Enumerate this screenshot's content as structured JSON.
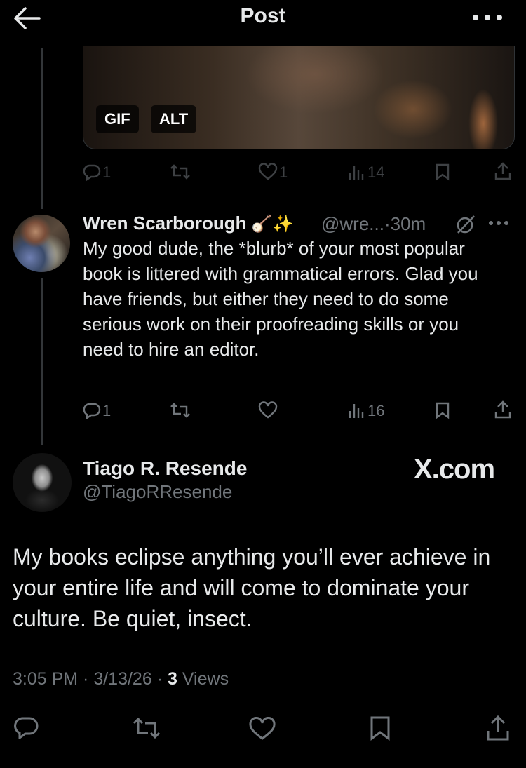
{
  "header": {
    "title": "Post"
  },
  "media": {
    "gif_label": "GIF",
    "alt_label": "ALT"
  },
  "media_actions": {
    "replies": "1",
    "likes": "1",
    "views": "14"
  },
  "reply": {
    "name": "Wren Scarborough",
    "name_emoji": "🪕✨",
    "handle": "@wre...",
    "time": "·30m",
    "text": "My good dude, the *blurb* of your most popular book is littered with grammatical errors. Glad you have friends, but either they need to do some serious work on their proofreading skills or you need to hire an editor.",
    "replies": "1",
    "views": "16"
  },
  "quoted": {
    "name": "Tiago R. Resende",
    "handle": "@TiagoRResende",
    "source": "X.com",
    "text": "My books eclipse anything you’ll ever achieve in your entire life and will come to dominate your culture. Be quiet, insect.",
    "time": "3:05 PM",
    "date": "3/13/26",
    "views_count": "3",
    "views_label": "Views"
  },
  "colors": {
    "background": "#000000",
    "text": "#e7e9ea",
    "muted": "#71767b",
    "faded": "#3e4144"
  }
}
